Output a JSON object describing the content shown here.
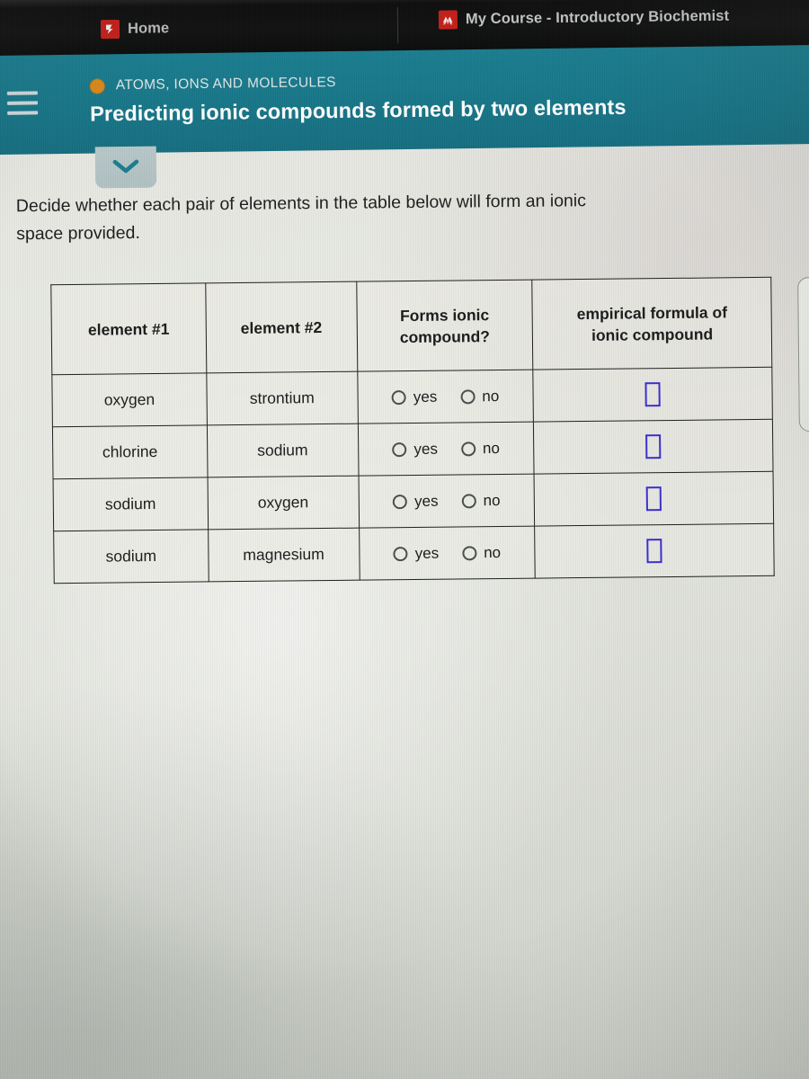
{
  "browser": {
    "tabs": [
      {
        "label": "Home",
        "favicon": "red-square-favicon"
      },
      {
        "label": "My Course - Introductory Biochemist",
        "favicon": "red-square-favicon"
      }
    ]
  },
  "header": {
    "menu_icon": "hamburger-icon",
    "category_dot_color": "#d98a1c",
    "category": "ATOMS, IONS AND MOLECULES",
    "title": "Predicting ionic compounds formed by two elements",
    "background_color": "#18788a",
    "collapse_icon": "chevron-down-icon"
  },
  "instruction": {
    "line1": "Decide whether each pair of elements in the table below will form an ionic",
    "line2": "space provided."
  },
  "table": {
    "columns": [
      "element #1",
      "element #2",
      "Forms ionic compound?",
      "empirical formula of ionic compound"
    ],
    "column_header_lines": {
      "forms_l1": "Forms ionic",
      "forms_l2": "compound?",
      "formula_l1": "empirical formula of",
      "formula_l2": "ionic compound"
    },
    "choice_labels": {
      "yes": "yes",
      "no": "no"
    },
    "answer_box_color": "#3b2fcf",
    "rows": [
      {
        "element1": "oxygen",
        "element2": "strontium",
        "selected": "",
        "formula": ""
      },
      {
        "element1": "chlorine",
        "element2": "sodium",
        "selected": "",
        "formula": ""
      },
      {
        "element1": "sodium",
        "element2": "oxygen",
        "selected": "",
        "formula": ""
      },
      {
        "element1": "sodium",
        "element2": "magnesium",
        "selected": "",
        "formula": ""
      }
    ]
  }
}
